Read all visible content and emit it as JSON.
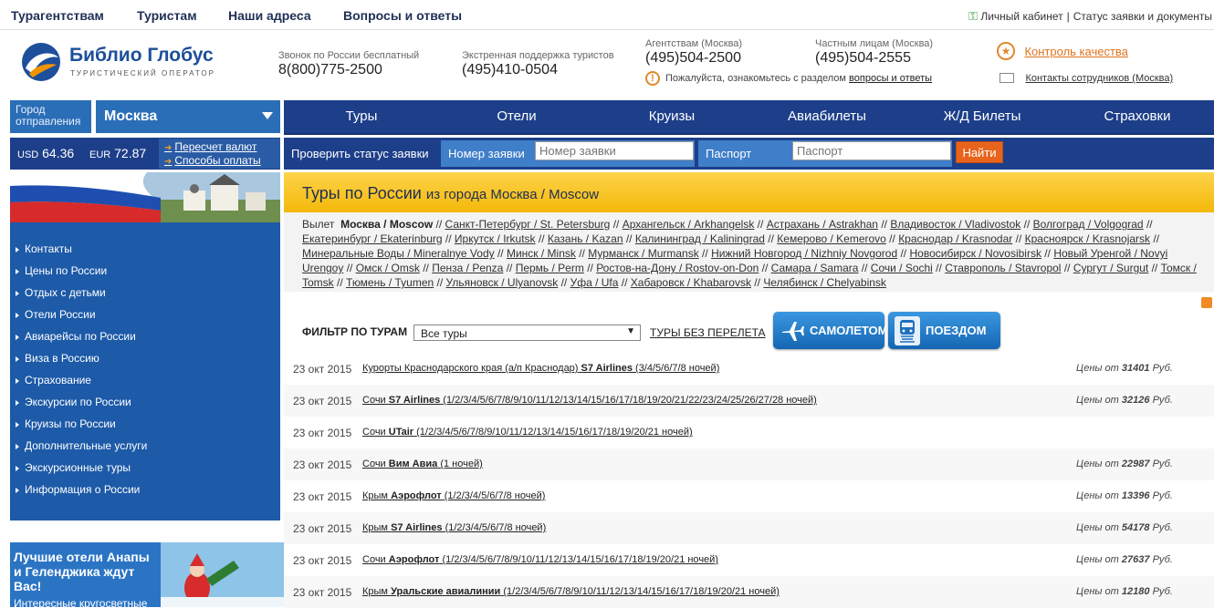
{
  "topnav": {
    "items": [
      "Турагентствам",
      "Туристам",
      "Наши адреса",
      "Вопросы и ответы"
    ],
    "cabinet": "Личный кабинет",
    "separator": "|",
    "status": "Статус заявки и документы"
  },
  "header": {
    "logo_name": "Библио Глобус",
    "logo_sub": "ТУРИСТИЧЕСКИЙ ОПЕРАТОР",
    "phones": [
      {
        "label": "Звонок по России бесплатный",
        "number": "8(800)775-2500"
      },
      {
        "label": "Экстренная поддержка туристов",
        "number": "(495)410-0504"
      },
      {
        "label": "Агентствам (Москва)",
        "number": "(495)504-2500"
      },
      {
        "label": "Частным лицам (Москва)",
        "number": "(495)504-2555"
      }
    ],
    "notice_text": "Пожалуйста, ознакомьтесь с разделом",
    "notice_link": "вопросы и ответы",
    "quality_link": "Контроль качества",
    "contacts_link": "Контакты сотрудников (Москва)"
  },
  "city": {
    "label": "Город отправления",
    "value": "Москва"
  },
  "main_menu": [
    "Туры",
    "Отели",
    "Круизы",
    "Авиабилеты",
    "Ж/Д Билеты",
    "Страховки"
  ],
  "currency": {
    "usd_label": "USD",
    "usd_value": "64.36",
    "eur_label": "EUR",
    "eur_value": "72.87",
    "recalc": "Пересчет валют",
    "payment": "Способы оплаты"
  },
  "status_check": {
    "label": "Проверить статус заявки",
    "order_label": "Номер заявки",
    "order_placeholder": "Номер заявки",
    "passport_label": "Паспорт",
    "passport_placeholder": "Паспорт",
    "find_button": "Найти"
  },
  "sidebar": {
    "items": [
      "Контакты",
      "Цены по России",
      "Отдых с детьми",
      "Отели России",
      "Авиарейсы по России",
      "Виза в Россию",
      "Страхование",
      "Экскурсии по России",
      "Круизы по России",
      "Дополнительные услуги",
      "Экскурсионные туры",
      "Информация о России"
    ],
    "promo_text": "Лучшие отели Анапы и Геленджика ждут Вас!",
    "promo_text2": "Интересные кругосветные"
  },
  "page": {
    "title": "Туры по России",
    "subtitle": "из города Москва / Moscow"
  },
  "departures": {
    "label": "Вылет",
    "current": "Москва / Moscow",
    "cities": [
      "Санкт-Петербург / St. Petersburg",
      "Архангельск / Arkhangelsk",
      "Астрахань / Astrakhan",
      "Владивосток / Vladivostok",
      "Волгоград / Volgograd",
      "Екатеринбург / Ekaterinburg",
      "Иркутск / Irkutsk",
      "Казань / Kazan",
      "Калининград / Kaliningrad",
      "Кемерово / Kemerovo",
      "Краснодар / Krasnodar",
      "Красноярск / Krasnojarsk",
      "Минеральные Воды / Mineralnye Vody",
      "Минск / Minsk",
      "Мурманск / Murmansk",
      "Нижний Новгород / Nizhniy Novgorod",
      "Новосибирск / Novosibirsk",
      "Новый Уренгой / Novyi Urengoy",
      "Омск / Omsk",
      "Пенза / Penza",
      "Пермь / Perm",
      "Ростов-на-Дону / Rostov-on-Don",
      "Самара / Samara",
      "Сочи / Sochi",
      "Ставрополь / Stavropol",
      "Сургут / Surgut",
      "Томск / Tomsk",
      "Тюмень / Tyumen",
      "Ульяновск / Ulyanovsk",
      "Уфа / Ufa",
      "Хабаровск / Khabarovsk",
      "Челябинск / Chelyabinsk"
    ]
  },
  "filter": {
    "label": "ФИЛЬТР ПО ТУРАМ",
    "selected": "Все туры",
    "no_flight": "ТУРЫ БЕЗ ПЕРЕЛЕТА",
    "plane_button": "САМОЛЕТОМ",
    "train_button": "ПОЕЗДОМ"
  },
  "tours": [
    {
      "date": "23 окт 2015",
      "dest": "Курорты Краснодарского края (а/п Краснодар)",
      "carrier": "S7 Airlines",
      "nights": "(3/4/5/6/7/8 ночей)",
      "price_label": "Цены от",
      "price": "31401",
      "currency": "Руб."
    },
    {
      "date": "23 окт 2015",
      "dest": "Сочи",
      "carrier": "S7 Airlines",
      "nights": "(1/2/3/4/5/6/7/8/9/10/11/12/13/14/15/16/17/18/19/20/21/22/23/24/25/26/27/28 ночей)",
      "price_label": "Цены от",
      "price": "32126",
      "currency": "Руб."
    },
    {
      "date": "23 окт 2015",
      "dest": "Сочи",
      "carrier": "UTair",
      "nights": "(1/2/3/4/5/6/7/8/9/10/11/12/13/14/15/16/17/18/19/20/21 ночей)",
      "price_label": "",
      "price": "",
      "currency": ""
    },
    {
      "date": "23 окт 2015",
      "dest": "Сочи",
      "carrier": "Вим Авиа",
      "nights": "(1 ночей)",
      "price_label": "Цены от",
      "price": "22987",
      "currency": "Руб."
    },
    {
      "date": "23 окт 2015",
      "dest": "Крым",
      "carrier": "Аэрофлот",
      "nights": "(1/2/3/4/5/6/7/8 ночей)",
      "price_label": "Цены от",
      "price": "13396",
      "currency": "Руб."
    },
    {
      "date": "23 окт 2015",
      "dest": "Крым",
      "carrier": "S7 Airlines",
      "nights": "(1/2/3/4/5/6/7/8 ночей)",
      "price_label": "Цены от",
      "price": "54178",
      "currency": "Руб."
    },
    {
      "date": "23 окт 2015",
      "dest": "Сочи",
      "carrier": "Аэрофлот",
      "nights": "(1/2/3/4/5/6/7/8/9/10/11/12/13/14/15/16/17/18/19/20/21 ночей)",
      "price_label": "Цены от",
      "price": "27637",
      "currency": "Руб."
    },
    {
      "date": "23 окт 2015",
      "dest": "Крым",
      "carrier": "Уральские авиалинии",
      "nights": "(1/2/3/4/5/6/7/8/9/10/11/12/13/14/15/16/17/18/19/20/21 ночей)",
      "price_label": "Цены от",
      "price": "12180",
      "currency": "Руб."
    }
  ],
  "colors": {
    "brand_blue": "#1d3f8a",
    "accent_orange": "#e8641c",
    "title_yellow": "#f8c116",
    "sidebar_blue": "#1d5aa8"
  }
}
